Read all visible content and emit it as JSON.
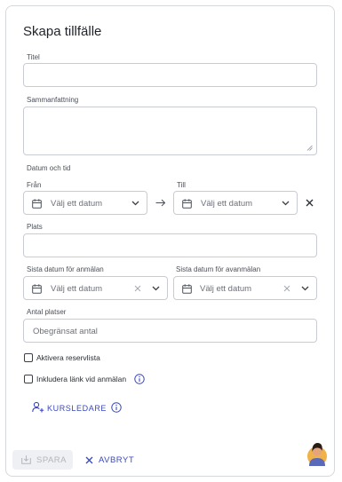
{
  "form": {
    "title": "Skapa tillfälle",
    "titel_label": "Titel",
    "summary_label": "Sammanfattning",
    "datetime_label": "Datum och tid",
    "from_label": "Från",
    "from_placeholder": "Välj ett datum",
    "to_label": "Till",
    "to_placeholder": "Välj ett datum",
    "place_label": "Plats",
    "signup_deadline_label": "Sista datum för anmälan",
    "signup_deadline_placeholder": "Välj ett datum",
    "cancel_deadline_label": "Sista datum för avanmälan",
    "cancel_deadline_placeholder": "Välj ett datum",
    "seats_label": "Antal platser",
    "seats_placeholder": "Obegränsat antal",
    "reserve_list_label": "Aktivera reservlista",
    "include_link_label": "Inkludera länk vid anmälan",
    "course_leader_label": "KURSLEDARE"
  },
  "footer": {
    "save_label": "SPARA",
    "cancel_label": "AVBRYT"
  },
  "colors": {
    "accent": "#3a49c2",
    "border": "#c8ccd2",
    "muted": "#b2b6bd"
  },
  "icons": [
    "calendar-icon",
    "chevron-down-icon",
    "arrow-right-icon",
    "close-icon",
    "info-icon",
    "add-person-icon",
    "save-icon",
    "avatar"
  ]
}
